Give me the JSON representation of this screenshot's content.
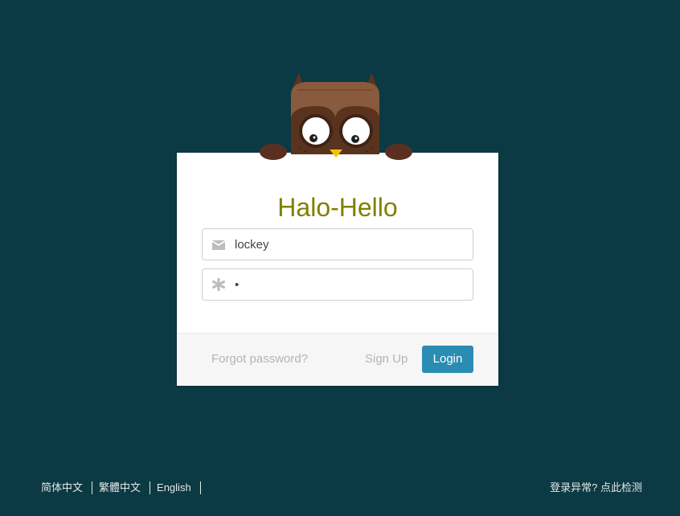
{
  "brand": {
    "title": "Halo-Hello",
    "mascot_icon": "owl-mascot-icon"
  },
  "form": {
    "username": {
      "value": "lockey",
      "icon": "envelope-icon"
    },
    "password": {
      "value": "•",
      "icon": "asterisk-icon"
    }
  },
  "footer": {
    "forgot_label": "Forgot password?",
    "signup_label": "Sign Up",
    "login_label": "Login"
  },
  "languages": [
    "简体中文",
    "繁體中文",
    "English"
  ],
  "check_link": "登录异常? 点此检测",
  "colors": {
    "background": "#0b3a44",
    "title": "#808000",
    "login_button": "#2a8cb3",
    "muted_text": "#b4b4b4"
  }
}
